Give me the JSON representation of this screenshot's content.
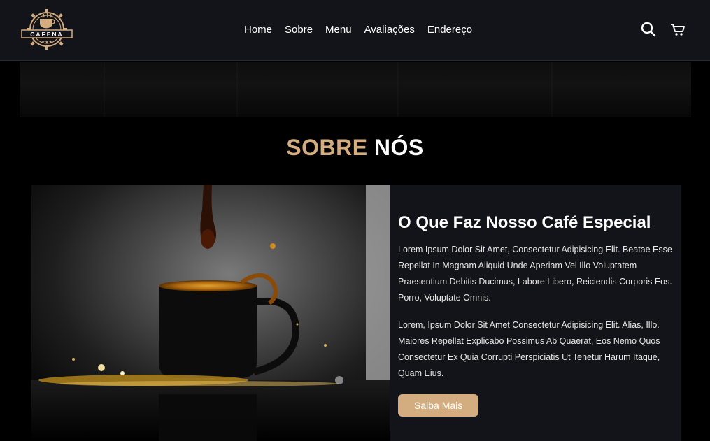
{
  "header": {
    "logo_text": "CAFENA",
    "nav": [
      "Home",
      "Sobre",
      "Menu",
      "Avaliações",
      "Endereço"
    ],
    "icons": [
      "search-icon",
      "cart-icon"
    ]
  },
  "section": {
    "title_accent": "SOBRE",
    "title_rest": "NÓS"
  },
  "about": {
    "heading": "O Que Faz Nosso Café Especial",
    "paragraph_1": "Lorem Ipsum Dolor Sit Amet, Consectetur Adipisicing Elit. Beatae Esse Repellat In Magnam Aliquid Unde Aperiam Vel Illo Voluptatem Praesentium Debitis Ducimus, Labore Libero, Reiciendis Corporis Eos. Porro, Voluptate Omnis.",
    "paragraph_2": "Lorem, Ipsum Dolor Sit Amet Consectetur Adipisicing Elit. Alias, Illo. Maiores Repellat Explicabo Possimus Ab Quaerat, Eos Nemo Quos Consectetur Ex Quia Corrupti Perspiciatis Ut Tenetur Harum Itaque, Quam Eius.",
    "button_label": "Saiba Mais"
  },
  "colors": {
    "accent": "#d3ad7f",
    "navbar_bg": "#13131a",
    "page_bg": "#000000"
  }
}
